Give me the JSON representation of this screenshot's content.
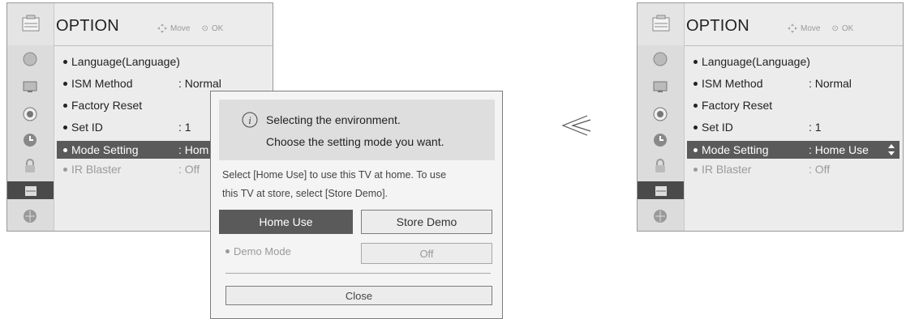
{
  "arrow_symbol": "≪",
  "left_menu": {
    "title": "OPTION",
    "hint_move": "Move",
    "hint_ok": "OK",
    "items": [
      {
        "label": "Language(Language)",
        "value": ""
      },
      {
        "label": "ISM Method",
        "value": ": Normal"
      },
      {
        "label": "Factory Reset",
        "value": ""
      },
      {
        "label": "Set ID",
        "value": ": 1"
      },
      {
        "label": "Mode Setting",
        "value": ": Hom"
      },
      {
        "label": "IR Blaster",
        "value": ": Off"
      }
    ]
  },
  "right_menu": {
    "title": "OPTION",
    "hint_move": "Move",
    "hint_ok": "OK",
    "items": [
      {
        "label": "Language(Language)",
        "value": ""
      },
      {
        "label": "ISM Method",
        "value": ": Normal"
      },
      {
        "label": "Factory Reset",
        "value": ""
      },
      {
        "label": "Set ID",
        "value": ": 1"
      },
      {
        "label": "Mode Setting",
        "value": ": Home Use"
      },
      {
        "label": "IR Blaster",
        "value": ": Off"
      }
    ]
  },
  "dialog": {
    "info_line1": "Selecting the environment.",
    "info_line2": "Choose the setting mode you want.",
    "description_line1": "Select [Home Use] to use this TV at home. To use",
    "description_line2": "this TV at store, select [Store Demo].",
    "home_use": "Home Use",
    "store_demo": "Store Demo",
    "demo_mode_label": "Demo Mode",
    "demo_mode_value": "Off",
    "close": "Close"
  },
  "sidebar_icons": [
    "picture-icon",
    "screen-icon",
    "audio-icon",
    "time-icon",
    "lock-icon",
    "option-icon",
    "network-icon"
  ],
  "colors": {
    "highlight": "#5a5a5a",
    "panel": "#ececec",
    "dim_text": "#9a9a9a"
  }
}
